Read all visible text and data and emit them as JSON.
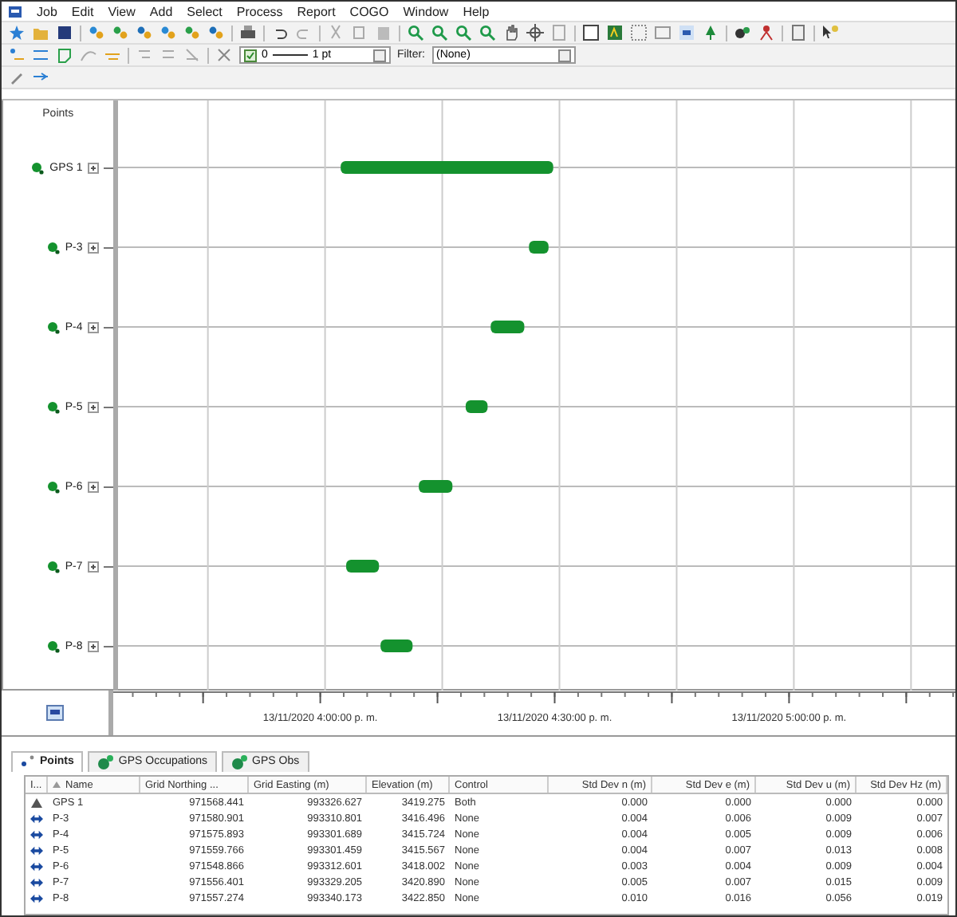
{
  "menu": [
    "Job",
    "Edit",
    "View",
    "Add",
    "Select",
    "Process",
    "Report",
    "COGO",
    "Window",
    "Help"
  ],
  "filter_bar": {
    "checked": true,
    "line_start": "0",
    "line_end": "1 pt",
    "filter_label": "Filter:",
    "filter_value": "(None)"
  },
  "timeline": {
    "header": "Points",
    "points": [
      "GPS 1",
      "P-3",
      "P-4",
      "P-5",
      "P-6",
      "P-7",
      "P-8"
    ],
    "axis_labels": [
      "13/11/2020 4:00:00 p. m.",
      "13/11/2020 4:30:00 p. m.",
      "13/11/2020 5:00:00 p. m."
    ]
  },
  "tabs": [
    {
      "label": "Points",
      "selected": true
    },
    {
      "label": "GPS Occupations",
      "selected": false
    },
    {
      "label": "GPS Obs",
      "selected": false
    }
  ],
  "table": {
    "icon_column": "I...",
    "columns": [
      "Name",
      "Grid Northing ...",
      "Grid Easting (m)",
      "Elevation (m)",
      "Control",
      "Std Dev n (m)",
      "Std Dev e (m)",
      "Std Dev u (m)",
      "Std Dev Hz (m)"
    ],
    "rows": [
      {
        "kind": "control",
        "cells": [
          "GPS 1",
          "971568.441",
          "993326.627",
          "3419.275",
          "Both",
          "0.000",
          "0.000",
          "0.000",
          "0.000"
        ]
      },
      {
        "kind": "point",
        "cells": [
          "P-3",
          "971580.901",
          "993310.801",
          "3416.496",
          "None",
          "0.004",
          "0.006",
          "0.009",
          "0.007"
        ]
      },
      {
        "kind": "point",
        "cells": [
          "P-4",
          "971575.893",
          "993301.689",
          "3415.724",
          "None",
          "0.004",
          "0.005",
          "0.009",
          "0.006"
        ]
      },
      {
        "kind": "point",
        "cells": [
          "P-5",
          "971559.766",
          "993301.459",
          "3415.567",
          "None",
          "0.004",
          "0.007",
          "0.013",
          "0.008"
        ]
      },
      {
        "kind": "point",
        "cells": [
          "P-6",
          "971548.866",
          "993312.601",
          "3418.002",
          "None",
          "0.003",
          "0.004",
          "0.009",
          "0.004"
        ]
      },
      {
        "kind": "point",
        "cells": [
          "P-7",
          "971556.401",
          "993329.205",
          "3420.890",
          "None",
          "0.005",
          "0.007",
          "0.015",
          "0.009"
        ]
      },
      {
        "kind": "point",
        "cells": [
          "P-8",
          "971557.274",
          "993340.173",
          "3422.850",
          "None",
          "0.010",
          "0.016",
          "0.056",
          "0.019"
        ]
      }
    ]
  }
}
